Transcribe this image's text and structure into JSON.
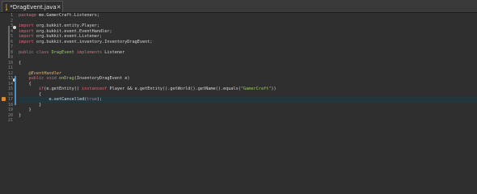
{
  "tab": {
    "label": "*DragEvent.java",
    "close": "✕",
    "icon": "java-file-icon"
  },
  "colors": {
    "background": "#2f2f2f",
    "keyword": "#d66a7d",
    "annotation": "#e6b36a",
    "string": "#9ccc65",
    "current_line": "#24363d"
  },
  "line_numbers": [
    "1",
    "2",
    "3",
    "4",
    "5",
    "6",
    "7",
    "8",
    "9",
    "10",
    "11",
    "12",
    "13",
    "14",
    "15",
    "16",
    "17",
    "18",
    "19",
    "20",
    "21"
  ],
  "code": [
    [
      {
        "t": "package ",
        "c": "kw"
      },
      {
        "t": "me.GamerCraft.Listeners;",
        "c": "plain"
      }
    ],
    [],
    [
      {
        "t": "import ",
        "c": "kw"
      },
      {
        "t": "org.bukkit.entity.Player;",
        "c": "plain"
      }
    ],
    [
      {
        "t": "import ",
        "c": "kw"
      },
      {
        "t": "org.bukkit.event.EventHandler;",
        "c": "plain"
      }
    ],
    [
      {
        "t": "import ",
        "c": "kw"
      },
      {
        "t": "org.bukkit.event.Listener;",
        "c": "plain"
      }
    ],
    [
      {
        "t": "import ",
        "c": "kw"
      },
      {
        "t": "org.bukkit.event.inventory.InventoryDragEvent;",
        "c": "plain"
      }
    ],
    [],
    [
      {
        "t": "public class ",
        "c": "kw"
      },
      {
        "t": "DragEvent ",
        "c": "type"
      },
      {
        "t": "implements ",
        "c": "kw"
      },
      {
        "t": "Listener",
        "c": "plain"
      }
    ],
    [],
    [
      {
        "t": "{",
        "c": "plain"
      }
    ],
    [],
    [
      {
        "t": "    @EventHandler",
        "c": "ann"
      }
    ],
    [
      {
        "t": "    public void ",
        "c": "kw"
      },
      {
        "t": "onDrag",
        "c": "type"
      },
      {
        "t": "(InventoryDragEvent e)",
        "c": "plain"
      }
    ],
    [
      {
        "t": "    {",
        "c": "plain"
      }
    ],
    [
      {
        "t": "        if",
        "c": "kw"
      },
      {
        "t": "(e.getEntity() ",
        "c": "plain"
      },
      {
        "t": "instanceof ",
        "c": "kw"
      },
      {
        "t": "Player && e.getEntity().getWorld().getName().equals(",
        "c": "plain"
      },
      {
        "t": "\"GamerCraft\"",
        "c": "str"
      },
      {
        "t": "))",
        "c": "plain"
      }
    ],
    [
      {
        "t": "        {",
        "c": "plain"
      }
    ],
    [
      {
        "t": "            e.setCancelled(",
        "c": "plain"
      },
      {
        "t": "true",
        "c": "kw"
      },
      {
        "t": ");",
        "c": "plain"
      }
    ],
    [
      {
        "t": "        }",
        "c": "plain"
      }
    ],
    [
      {
        "t": "    }",
        "c": "plain"
      }
    ],
    [
      {
        "t": "}",
        "c": "plain"
      }
    ],
    []
  ]
}
